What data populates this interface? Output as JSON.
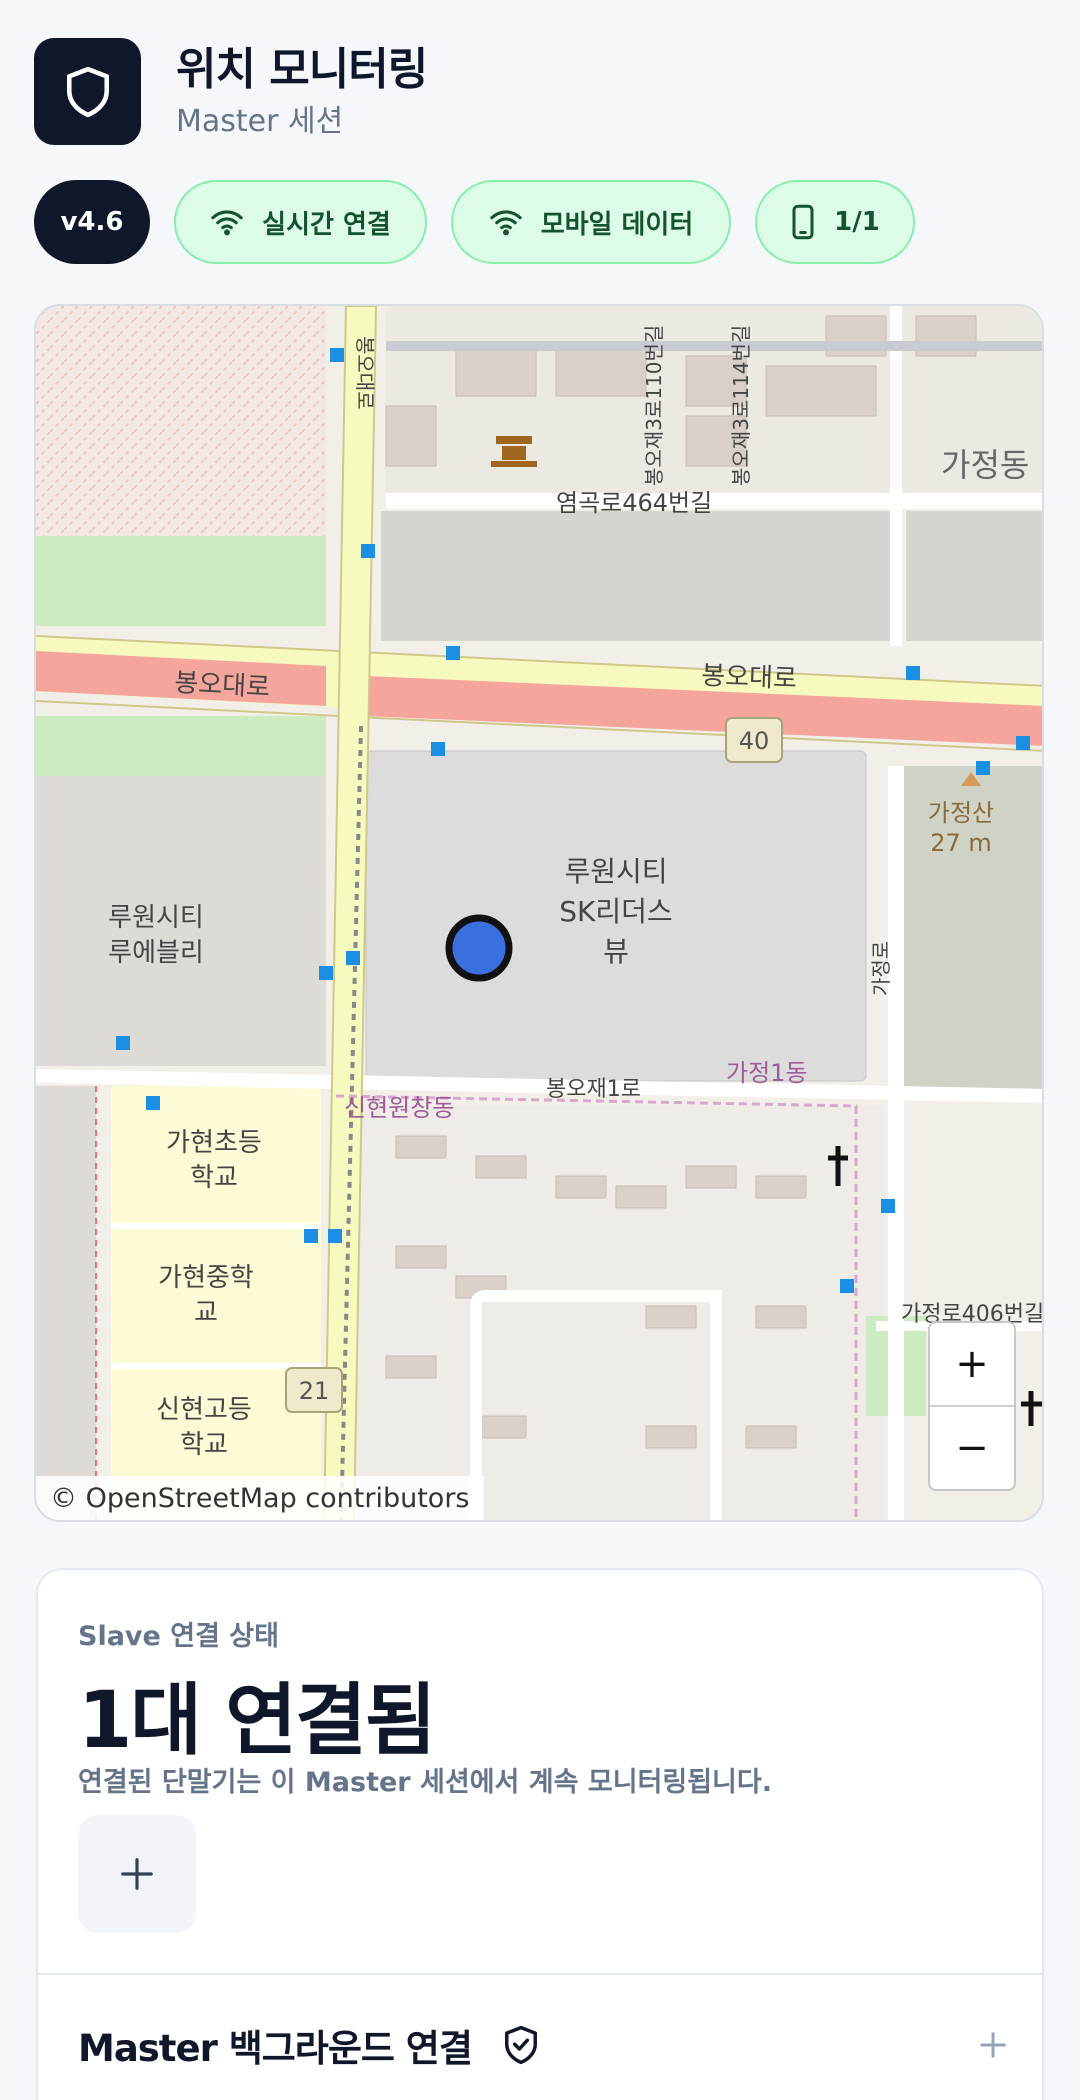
{
  "app": {
    "title": "위치 모니터링",
    "subtitle": "Master 세션"
  },
  "chips": {
    "version": "v4.6",
    "realtime": "실시간 연결",
    "network": "모바일 데이터",
    "devices": "1/1"
  },
  "map": {
    "labels": {
      "road_bongo_w": "봉오대로",
      "road_bongo_e": "봉오대로",
      "road_yeomgok": "염곡로464번길",
      "road_bongo1": "봉오재1로",
      "road_v1": "봉오재3로110번길",
      "road_v2": "봉오재3로114번길",
      "area_gajeong": "가정동",
      "area_gajeong1": "가정1동",
      "area_sinhyeon": "신현원창동",
      "apt_sk_1": "루원시티",
      "apt_sk_2": "SK리더스",
      "apt_sk_3": "뷰",
      "apt_rue_1": "루원시티",
      "apt_rue_2": "루에블리",
      "school_elem_1": "가현초등",
      "school_elem_2": "학교",
      "school_mid_1": "가현중학",
      "school_mid_2": "교",
      "school_high_1": "신현고등",
      "school_high_2": "학교",
      "mountain_name": "가정산",
      "mountain_height": "27 m",
      "route_40": "40",
      "route_21": "21",
      "road_gajeong": "가정로",
      "road_gajeong406": "가정로406번길",
      "road_v_left": "봉오대로"
    },
    "zoom_in": "+",
    "zoom_out": "−",
    "attribution": "© OpenStreetMap contributors"
  },
  "status": {
    "label": "Slave 연결 상태",
    "count": "1대 연결됨",
    "description": "연결된 단말기는 이 Master 세션에서 계속 모니터링됩니다.",
    "add_label": "+"
  },
  "background": {
    "title": "Master 백그라운드 연결",
    "expand_label": "+"
  },
  "colors": {
    "primary_dark": "#0f172a",
    "muted_text": "#64748b",
    "chip_green_bg": "#dcfce7",
    "chip_green_text": "#14532d",
    "location_marker": "#3b6fe0"
  }
}
